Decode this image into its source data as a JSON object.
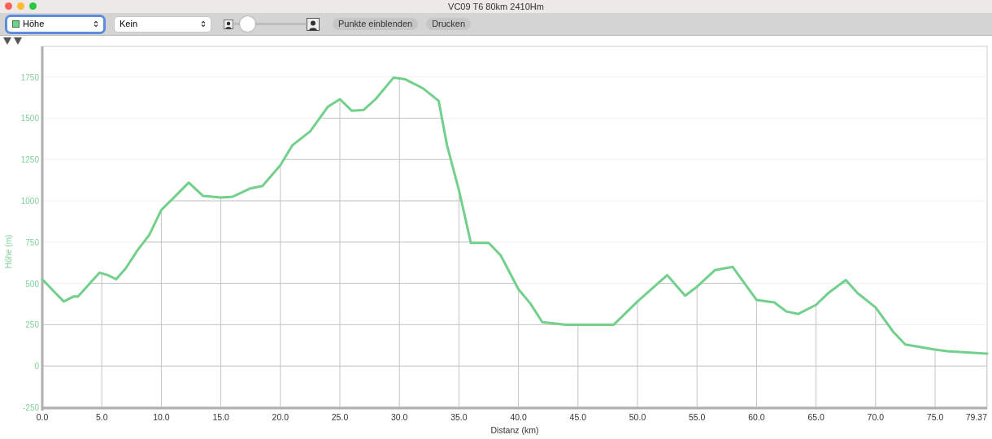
{
  "window": {
    "title": "VC09 T6 80km 2410Hm"
  },
  "toolbar": {
    "metric_select": {
      "value": "Höhe",
      "color": "#72d08c",
      "focused": true
    },
    "overlay_select": {
      "value": "Kein",
      "focused": false
    },
    "zoom_slider": {
      "level": 0.1
    },
    "buttons": [
      "Punkte einblenden",
      "Drucken"
    ]
  },
  "chart": {
    "chart_data": {
      "type": "line",
      "xlabel": "Distanz (km)",
      "ylabel": "Höhe (m)",
      "x": [
        0,
        1,
        1.8,
        2.6,
        3,
        4,
        4.8,
        5.5,
        6.2,
        7,
        8,
        9,
        10,
        11,
        12.3,
        13.5,
        15,
        16,
        17.5,
        18.5,
        20,
        21,
        22.5,
        24,
        25,
        26,
        27,
        28,
        29.5,
        30.5,
        32,
        33.3,
        34,
        35,
        36,
        37.5,
        38.5,
        40,
        41,
        42,
        44,
        48,
        50,
        52.5,
        54,
        55,
        56.5,
        58,
        60,
        61.5,
        62.5,
        63.5,
        65,
        66,
        67.5,
        68.5,
        70,
        71.5,
        72.5,
        75,
        76,
        79.37
      ],
      "series": [
        {
          "color": "#72d08c",
          "values": [
            525,
            450,
            390,
            420,
            420,
            500,
            565,
            550,
            525,
            590,
            700,
            795,
            945,
            1015,
            1110,
            1030,
            1020,
            1025,
            1075,
            1090,
            1215,
            1335,
            1420,
            1570,
            1615,
            1545,
            1550,
            1615,
            1745,
            1735,
            1680,
            1605,
            1335,
            1065,
            745,
            745,
            670,
            465,
            378,
            265,
            250,
            250,
            390,
            550,
            425,
            480,
            580,
            600,
            400,
            385,
            330,
            315,
            370,
            440,
            520,
            440,
            355,
            205,
            130,
            100,
            90,
            75
          ]
        }
      ],
      "grid": true,
      "xlim": [
        0,
        79.37
      ],
      "ylim": [
        -255,
        1935
      ],
      "xticks": [
        {
          "value": 0,
          "label": "0.0"
        },
        {
          "value": 5,
          "label": "5.0"
        },
        {
          "value": 10,
          "label": "10.0"
        },
        {
          "value": 15,
          "label": "15.0"
        },
        {
          "value": 20,
          "label": "20.0"
        },
        {
          "value": 25,
          "label": "25.0"
        },
        {
          "value": 30,
          "label": "30.0"
        },
        {
          "value": 35,
          "label": "35.0"
        },
        {
          "value": 40,
          "label": "40.0"
        },
        {
          "value": 45,
          "label": "45.0"
        },
        {
          "value": 50,
          "label": "50.0"
        },
        {
          "value": 55,
          "label": "55.0"
        },
        {
          "value": 60,
          "label": "60.0"
        },
        {
          "value": 65,
          "label": "65.0"
        },
        {
          "value": 70,
          "label": "70.0"
        },
        {
          "value": 75,
          "label": "75.0"
        },
        {
          "value": 79.37,
          "label": "79.37"
        }
      ],
      "yticks": [
        -250,
        0,
        250,
        500,
        750,
        1000,
        1250,
        1500,
        1750
      ]
    }
  }
}
